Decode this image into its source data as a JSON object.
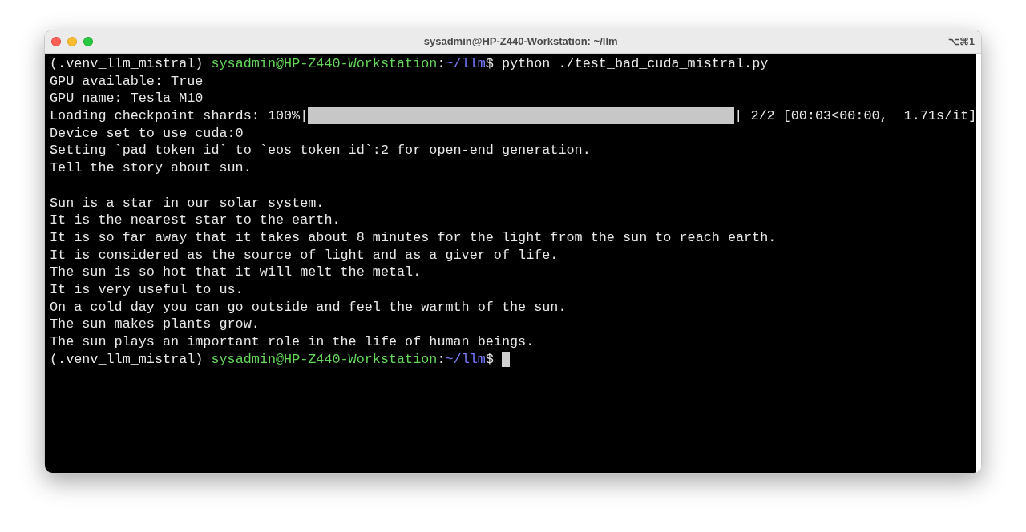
{
  "window": {
    "title": "sysadmin@HP-Z440-Workstation: ~/llm",
    "shortcut": "⌥⌘1"
  },
  "lines": [
    {
      "kind": "prompt",
      "env": "(.venv_llm_mistral) ",
      "user_host": "sysadmin@HP-Z440-Workstation",
      "colon": ":",
      "path": "~/llm",
      "dollar": "$ ",
      "command": "python ./test_bad_cuda_mistral.py",
      "cursor": false
    },
    {
      "kind": "text",
      "text": "GPU available: True"
    },
    {
      "kind": "text",
      "text": "GPU name: Tesla M10"
    },
    {
      "kind": "progress",
      "before": "Loading checkpoint shards: 100%|",
      "level": 1,
      "after": "| 2/2 [00:03<00:00,  1.71s/it]"
    },
    {
      "kind": "text",
      "text": "Device set to use cuda:0"
    },
    {
      "kind": "text",
      "text": "Setting `pad_token_id` to `eos_token_id`:2 for open-end generation."
    },
    {
      "kind": "text",
      "text": "Tell the story about sun."
    },
    {
      "kind": "blank"
    },
    {
      "kind": "text",
      "text": "Sun is a star in our solar system."
    },
    {
      "kind": "text",
      "text": "It is the nearest star to the earth."
    },
    {
      "kind": "text",
      "text": "It is so far away that it takes about 8 minutes for the light from the sun to reach earth."
    },
    {
      "kind": "text",
      "text": "It is considered as the source of light and as a giver of life."
    },
    {
      "kind": "text",
      "text": "The sun is so hot that it will melt the metal."
    },
    {
      "kind": "text",
      "text": "It is very useful to us."
    },
    {
      "kind": "text",
      "text": "On a cold day you can go outside and feel the warmth of the sun."
    },
    {
      "kind": "text",
      "text": "The sun makes plants grow."
    },
    {
      "kind": "text",
      "text": "The sun plays an important role in the life of human beings."
    },
    {
      "kind": "prompt",
      "env": "(.venv_llm_mistral) ",
      "user_host": "sysadmin@HP-Z440-Workstation",
      "colon": ":",
      "path": "~/llm",
      "dollar": "$ ",
      "cursor": true
    }
  ]
}
